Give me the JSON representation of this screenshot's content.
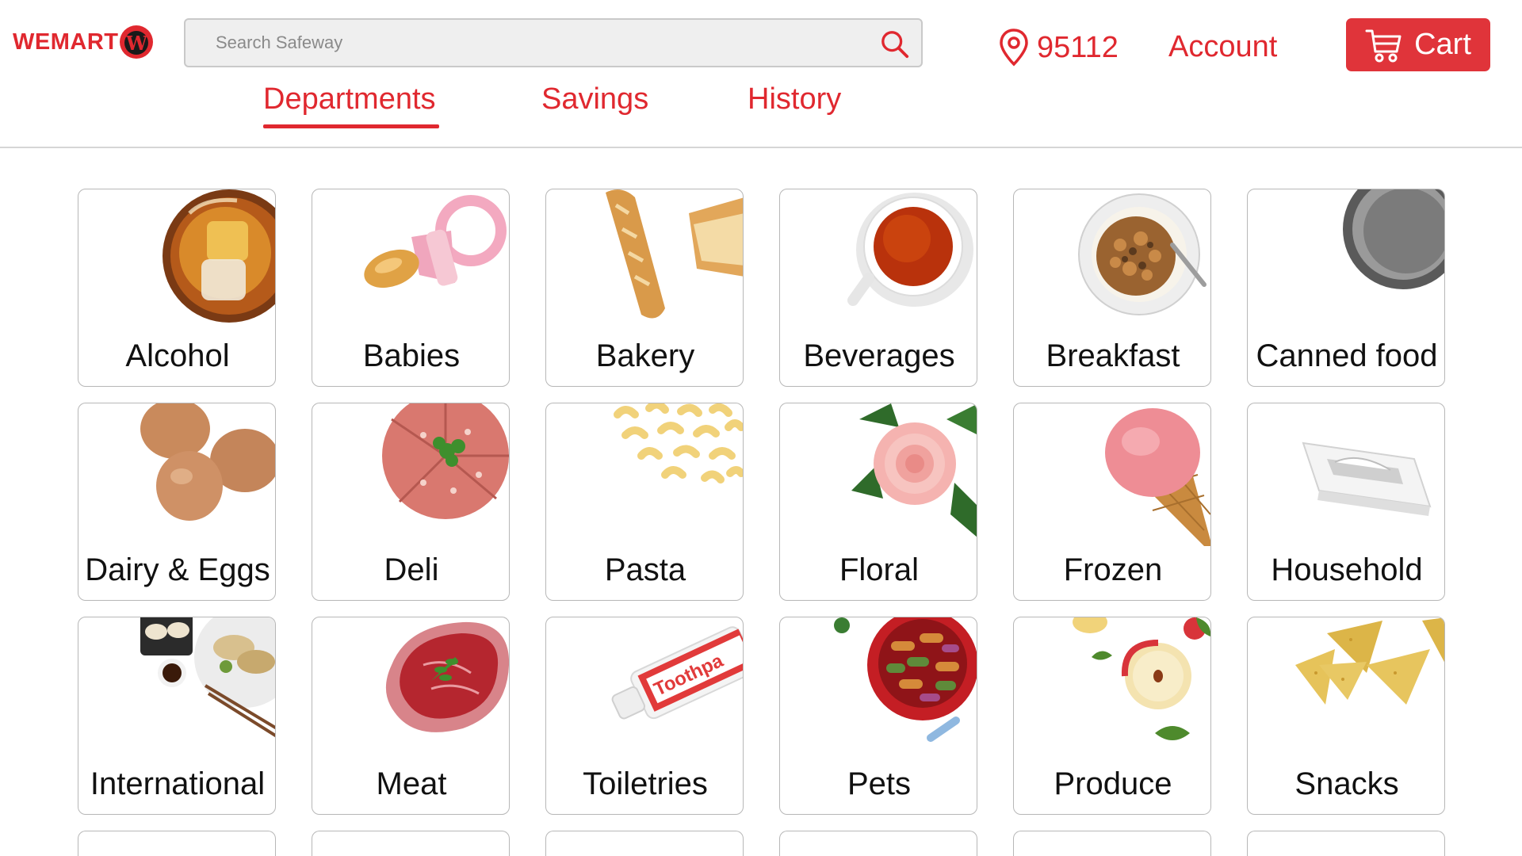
{
  "brand": {
    "logo_text": "WEMART",
    "logo_badge": "W",
    "accent": "#e0282f"
  },
  "search": {
    "placeholder": "Search Safeway",
    "value": "",
    "icon": "search-icon"
  },
  "location": {
    "zip": "95112",
    "icon": "location-pin-icon"
  },
  "account": {
    "label": "Account"
  },
  "cart": {
    "label": "Cart",
    "icon": "cart-icon"
  },
  "nav": {
    "tabs": [
      {
        "label": "Departments",
        "active": true
      },
      {
        "label": "Savings",
        "active": false
      },
      {
        "label": "History",
        "active": false
      }
    ]
  },
  "departments": [
    {
      "label": "Alcohol",
      "icon": "whiskey-glass-icon"
    },
    {
      "label": "Babies",
      "icon": "pacifier-icon"
    },
    {
      "label": "Bakery",
      "icon": "baguette-icon"
    },
    {
      "label": "Beverages",
      "icon": "tea-cup-icon"
    },
    {
      "label": "Breakfast",
      "icon": "cereal-bowl-icon"
    },
    {
      "label": "Canned food",
      "icon": "tin-can-icon"
    },
    {
      "label": "Dairy & Eggs",
      "icon": "eggs-icon"
    },
    {
      "label": "Deli",
      "icon": "salami-icon"
    },
    {
      "label": "Pasta",
      "icon": "macaroni-icon"
    },
    {
      "label": "Floral",
      "icon": "rose-icon"
    },
    {
      "label": "Frozen",
      "icon": "ice-cream-cone-icon"
    },
    {
      "label": "Household",
      "icon": "tissue-box-icon"
    },
    {
      "label": "International",
      "icon": "dumplings-icon"
    },
    {
      "label": "Meat",
      "icon": "steak-icon"
    },
    {
      "label": "Toiletries",
      "icon": "toothpaste-icon"
    },
    {
      "label": "Pets",
      "icon": "dog-bowl-icon"
    },
    {
      "label": "Produce",
      "icon": "apple-icon"
    },
    {
      "label": "Snacks",
      "icon": "tortilla-chips-icon"
    }
  ],
  "toothpaste_text": "Toothpa"
}
